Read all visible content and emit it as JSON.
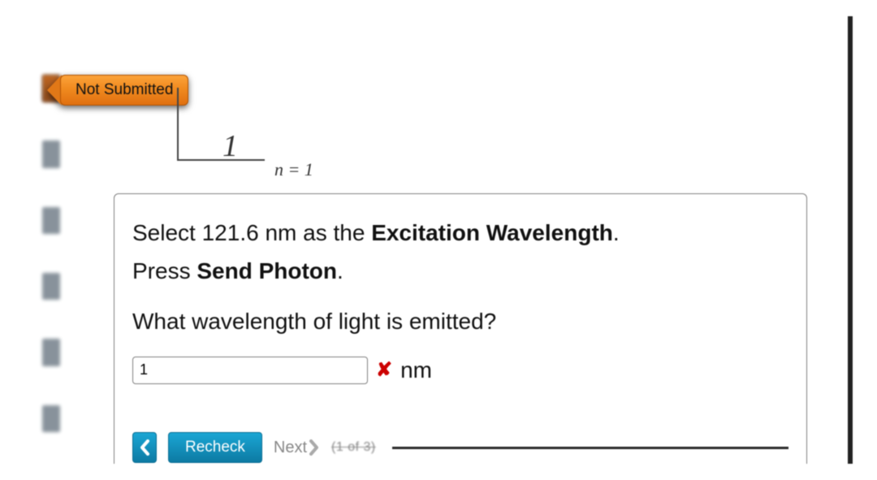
{
  "status_badge": "Not Submitted",
  "diagram": {
    "tick_value": "1",
    "level_label": "n = 1"
  },
  "question": {
    "line1_prefix": "Select 121.6 nm as the ",
    "line1_bold": "Excitation Wavelength",
    "line1_suffix": ".",
    "line2_prefix": "Press ",
    "line2_bold": "Send Photon",
    "line2_suffix": ".",
    "prompt": "What wavelength of light is emitted?"
  },
  "answer": {
    "value": "1",
    "unit": "nm",
    "incorrect_mark": "✘"
  },
  "controls": {
    "recheck_label": "Recheck",
    "next_label": "Next",
    "pager_text": "(1 of 3)"
  }
}
